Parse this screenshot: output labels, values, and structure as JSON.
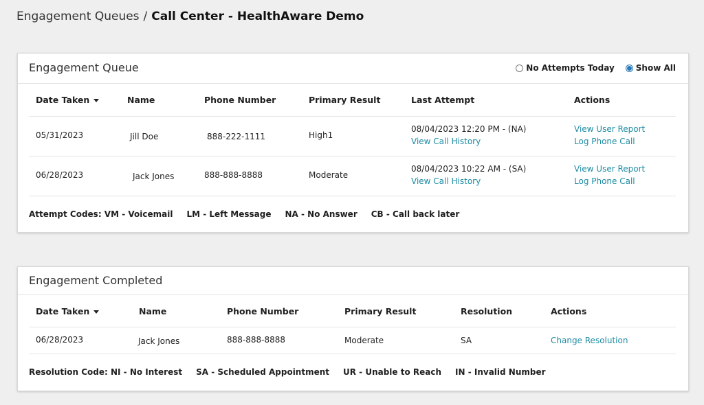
{
  "breadcrumb": {
    "parent": "Engagement Queues",
    "separator": "/",
    "current": "Call Center - HealthAware Demo"
  },
  "queue": {
    "title": "Engagement Queue",
    "filters": {
      "no_attempts": "No Attempts Today",
      "show_all": "Show All",
      "selected": "show_all"
    },
    "headers": {
      "date": "Date Taken",
      "name": "Name",
      "phone": "Phone Number",
      "result": "Primary Result",
      "last_attempt": "Last Attempt",
      "actions": "Actions"
    },
    "rows": [
      {
        "date": "05/31/2023",
        "name": "Jill Doe",
        "phone": "888-222-1111",
        "result": "High1",
        "last_attempt": "08/04/2023 12:20 PM - (NA)",
        "history_link": "View Call History",
        "report_link": "View User Report",
        "log_link": "Log Phone Call"
      },
      {
        "date": "06/28/2023",
        "name": "Jack Jones",
        "phone": "888-888-8888",
        "result": "Moderate",
        "last_attempt": "08/04/2023 10:22 AM - (SA)",
        "history_link": "View Call History",
        "report_link": "View User Report",
        "log_link": "Log Phone Call"
      }
    ],
    "codes": [
      "Attempt Codes: VM - Voicemail",
      "LM - Left Message",
      "NA - No Answer",
      "CB - Call back later"
    ]
  },
  "completed": {
    "title": "Engagement Completed",
    "headers": {
      "date": "Date Taken",
      "name": "Name",
      "phone": "Phone Number",
      "result": "Primary Result",
      "resolution": "Resolution",
      "actions": "Actions"
    },
    "rows": [
      {
        "date": "06/28/2023",
        "name": "Jack Jones",
        "phone": "888-888-8888",
        "result": "Moderate",
        "resolution": "SA",
        "change_link": "Change Resolution"
      }
    ],
    "codes": [
      "Resolution Code: NI - No Interest",
      "SA - Scheduled Appointment",
      "UR - Unable to Reach",
      "IN - Invalid Number"
    ]
  },
  "colors": {
    "link": "#1d8ba3",
    "radio_selected": "#2a7ab8",
    "background": "#efefef"
  }
}
